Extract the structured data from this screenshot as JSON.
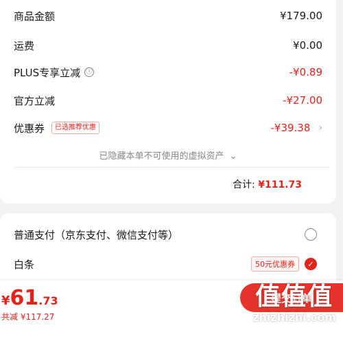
{
  "order_summary": {
    "goods_amount": {
      "label": "商品金额",
      "value": "¥179.00"
    },
    "shipping": {
      "label": "运费",
      "value": "¥0.00"
    },
    "plus_discount": {
      "label": "PLUS专享立减",
      "info_icon": "ⓘ",
      "value": "-¥0.89"
    },
    "official_discount": {
      "label": "官方立减",
      "value": "-¥27.00"
    },
    "coupon": {
      "label": "优惠券",
      "tag": "已选推荐优惠",
      "value": "-¥39.38"
    },
    "hidden_assets_text": "已隐藏本单不可使用的虚拟资产",
    "total_label": "合计:",
    "total_value": "¥111.73"
  },
  "payment": {
    "normal": {
      "label": "普通支付（京东支付、微信支付等）",
      "selected": false
    },
    "baitiao": {
      "label": "白条",
      "coupon_tag": "50元优惠券",
      "selected": true
    }
  },
  "bottom_bar": {
    "currency": "¥",
    "price_int": "61",
    "price_dec": ".73",
    "saved_text": "共减 ¥117.27",
    "submit_label": "提交订单"
  },
  "watermark": {
    "logo": "值值值",
    "site": "zhizhizhi.com"
  },
  "colors": {
    "accent": "#e2231a",
    "text": "#1a1a1a",
    "muted": "#888888",
    "background": "#f2f2f2"
  }
}
